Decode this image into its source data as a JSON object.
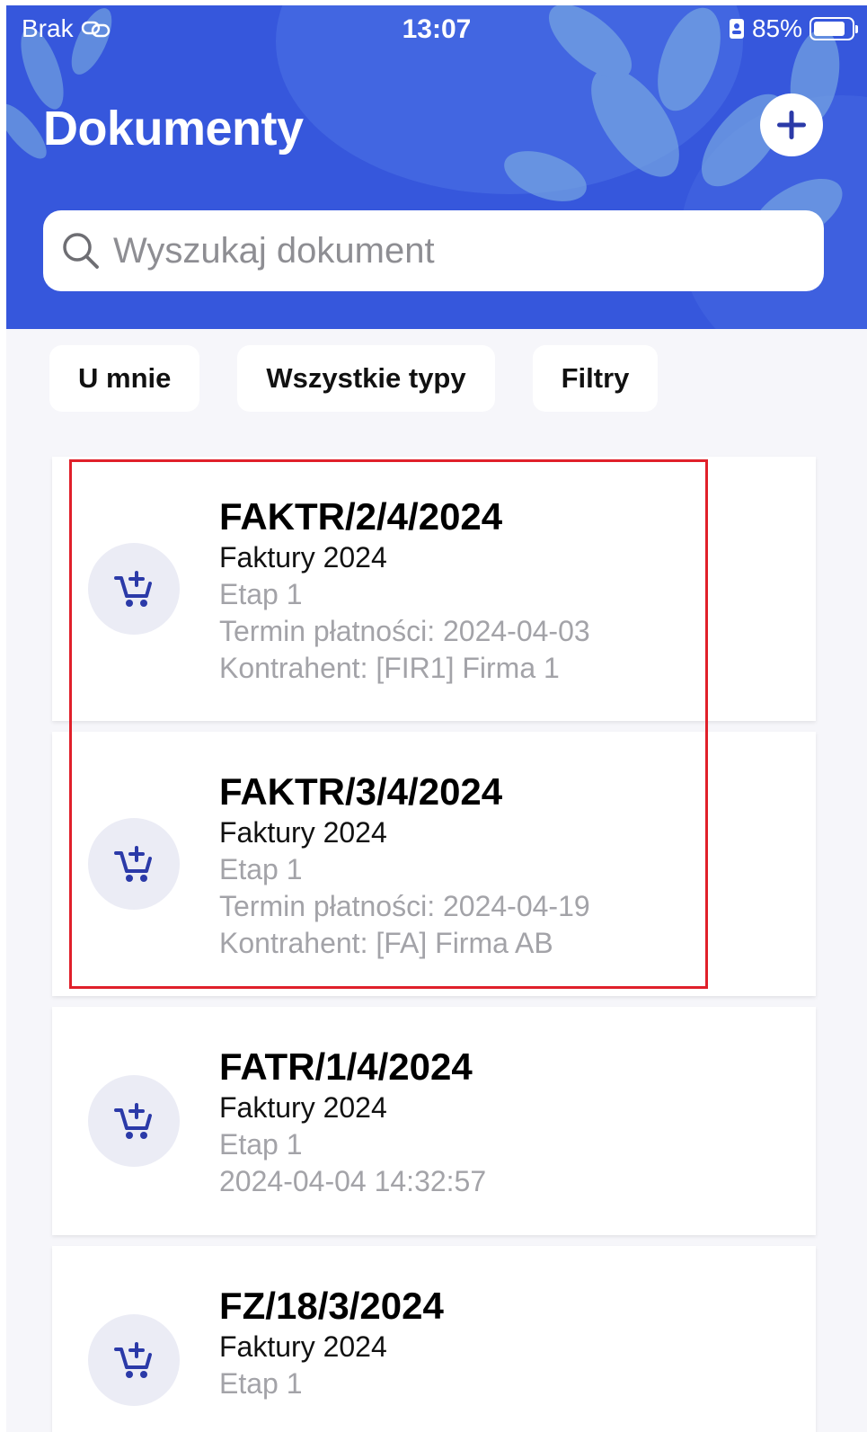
{
  "status_bar": {
    "carrier": "Brak",
    "time": "13:07",
    "battery": "85%",
    "battery_level": 0.85
  },
  "header": {
    "title": "Dokumenty",
    "add_icon": "plus-icon"
  },
  "search": {
    "placeholder": "Wyszukaj dokument",
    "icon": "search-icon"
  },
  "filters": [
    {
      "label": "U mnie"
    },
    {
      "label": "Wszystkie typy"
    },
    {
      "label": "Filtry"
    }
  ],
  "documents": [
    {
      "number": "FAKTR/2/4/2024",
      "type": "Faktury 2024",
      "stage": "Etap 1",
      "line3": "Termin płatności: 2024-04-03",
      "line4": "Kontrahent: [FIR1] Firma 1",
      "icon": "cart-add-icon"
    },
    {
      "number": "FAKTR/3/4/2024",
      "type": "Faktury 2024",
      "stage": "Etap 1",
      "line3": "Termin płatności: 2024-04-19",
      "line4": "Kontrahent: [FA] Firma AB",
      "icon": "cart-add-icon"
    },
    {
      "number": "FATR/1/4/2024",
      "type": "Faktury 2024",
      "stage": "Etap 1",
      "line3": "2024-04-04 14:32:57",
      "icon": "cart-add-icon"
    },
    {
      "number": "FZ/18/3/2024",
      "type": "Faktury 2024",
      "stage": "Etap 1",
      "icon": "cart-add-icon"
    }
  ],
  "colors": {
    "header_bg": "#3657dc",
    "icon_color": "#2b3aa8",
    "highlight": "#e0202a"
  }
}
